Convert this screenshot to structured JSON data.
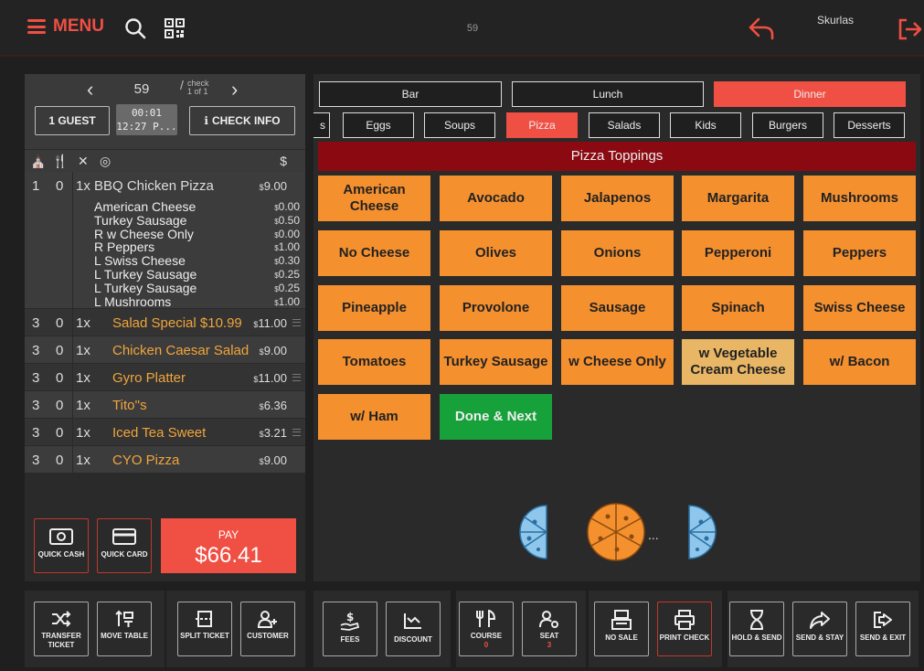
{
  "topbar": {
    "menu_label": "MENU",
    "center_number": "59",
    "user_name": "Skurlas"
  },
  "check": {
    "number": "59",
    "check_label": "check",
    "check_of": "1 of 1",
    "guest_label": "1 GUEST",
    "timer_line1": "00:01",
    "timer_line2": "12:27 P...",
    "check_info_label": "CHECK INFO",
    "currency_header": "$"
  },
  "order": {
    "first": {
      "seat": "1",
      "course": "0",
      "qty": "1x",
      "name": "BBQ Chicken Pizza",
      "price": "9.00",
      "modifiers": [
        {
          "name": "American Cheese",
          "price": "0.00"
        },
        {
          "name": "Turkey Sausage",
          "price": "0.50"
        },
        {
          "name": "R w Cheese Only",
          "price": "0.00"
        },
        {
          "name": "R Peppers",
          "price": "1.00"
        },
        {
          "name": "L Swiss Cheese",
          "price": "0.30"
        },
        {
          "name": "L Turkey Sausage",
          "price": "0.25"
        },
        {
          "name": "L Turkey Sausage",
          "price": "0.25"
        },
        {
          "name": "L Mushrooms",
          "price": "1.00"
        }
      ]
    },
    "rows": [
      {
        "seat": "3",
        "course": "0",
        "qty": "1x",
        "name": "Salad Special $10.99",
        "price": "11.00"
      },
      {
        "seat": "3",
        "course": "0",
        "qty": "1x",
        "name": "Chicken Caesar Salad",
        "price": "9.00"
      },
      {
        "seat": "3",
        "course": "0",
        "qty": "1x",
        "name": "Gyro Platter",
        "price": "11.00"
      },
      {
        "seat": "3",
        "course": "0",
        "qty": "1x",
        "name": "Tito''s",
        "price": "6.36"
      },
      {
        "seat": "3",
        "course": "0",
        "qty": "1x",
        "name": "Iced Tea Sweet",
        "price": "3.21"
      },
      {
        "seat": "3",
        "course": "0",
        "qty": "1x",
        "name": "CYO Pizza",
        "price": "9.00"
      }
    ],
    "currency_symbol": "$"
  },
  "payment": {
    "quick_cash": "QUICK CASH",
    "quick_card": "QUICK CARD",
    "pay_label": "PAY",
    "pay_amount": "$66.41"
  },
  "menus": [
    "Bar",
    "Lunch",
    "Dinner"
  ],
  "active_menu": "Dinner",
  "categories": {
    "partial": "s",
    "items": [
      "Eggs",
      "Soups",
      "Pizza",
      "Salads",
      "Kids",
      "Burgers",
      "Desserts"
    ],
    "active": "Pizza"
  },
  "group_title": "Pizza Toppings",
  "toppings": [
    "American Cheese",
    "Avocado",
    "Jalapenos",
    "Margarita",
    "Mushrooms",
    "No Cheese",
    "Olives",
    "Onions",
    "Pepperoni",
    "Peppers",
    "Pineapple",
    "Provolone",
    "Sausage",
    "Spinach",
    "Swiss Cheese",
    "Tomatoes",
    "Turkey Sausage",
    "w Cheese Only",
    "w Vegetable Cream Cheese",
    "w/ Bacon",
    "w/ Ham",
    "Done & Next"
  ],
  "colors": {
    "accent": "#f04f43",
    "topping": "#f5902f",
    "topping_selected": "#e8b665",
    "done": "#17a13a",
    "group_header": "#8b0a12",
    "pizza_half": "#8ec6ec",
    "pizza_whole": "#f5902f"
  },
  "pizza_selector": {
    "ellipsis": "..."
  },
  "actions": {
    "transfer_ticket": "TRANSFER TICKET",
    "move_table": "MOVE TABLE",
    "split_ticket": "SPLIT TICKET",
    "customer": "CUSTOMER",
    "fees": "FEES",
    "discount": "DISCOUNT",
    "course": "COURSE",
    "course_value": "0",
    "seat": "SEAT",
    "seat_value": "3",
    "no_sale": "NO SALE",
    "print_check": "PRINT CHECK",
    "hold_send": "HOLD & SEND",
    "send_stay": "SEND & STAY",
    "send_exit": "SEND & EXIT"
  }
}
